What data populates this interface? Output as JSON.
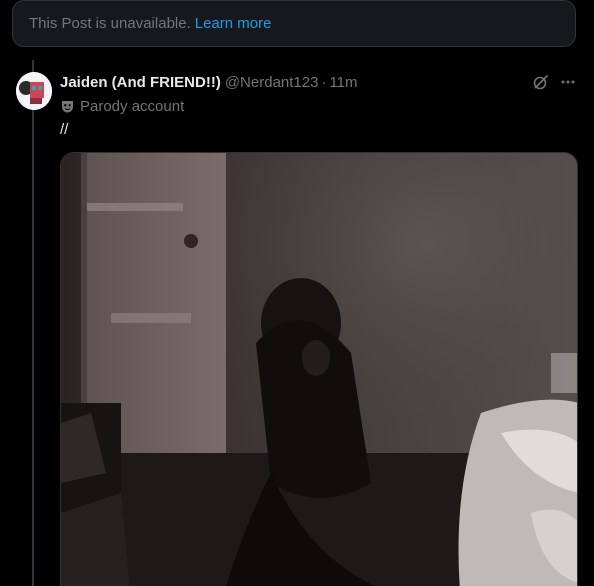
{
  "unavailable_notice": {
    "message": "This Post is unavailable.",
    "link_label": "Learn more"
  },
  "post": {
    "display_name": "Jaiden (And FRIEND!!)",
    "handle": "@Nerdant123",
    "separator": "·",
    "timestamp": "11m",
    "badge_label": "Parody account",
    "text": "//",
    "icons": {
      "badge": "mask-icon",
      "grok": "grok-icon",
      "more": "more-icon"
    }
  },
  "colors": {
    "background": "#000000",
    "link": "#1d9bf0",
    "muted": "#71767b",
    "border": "#2f3336"
  }
}
